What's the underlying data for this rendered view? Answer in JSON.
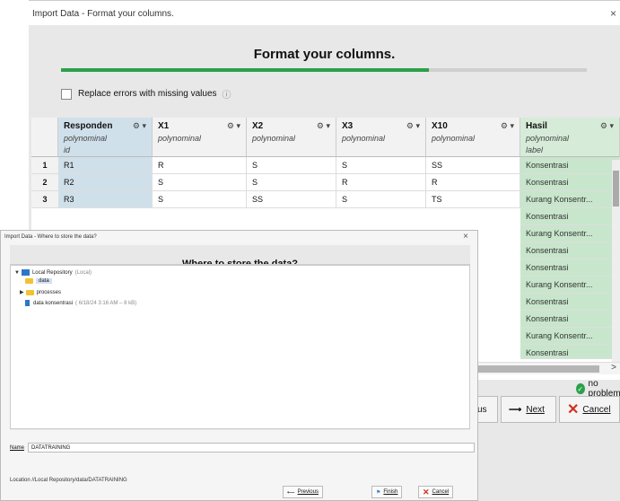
{
  "back": {
    "title": "Import Data - Format your columns.",
    "close": "×",
    "heading": "Format your columns.",
    "checkbox_label": "Replace errors with missing values",
    "columns": [
      {
        "name": "Responden",
        "type": "polynominal",
        "role": "id"
      },
      {
        "name": "X1",
        "type": "polynominal",
        "role": ""
      },
      {
        "name": "X2",
        "type": "polynominal",
        "role": ""
      },
      {
        "name": "X3",
        "type": "polynominal",
        "role": ""
      },
      {
        "name": "X10",
        "type": "polynominal",
        "role": ""
      },
      {
        "name": "Hasil",
        "type": "polynominal",
        "role": "label"
      }
    ],
    "rows": [
      {
        "num": "1",
        "cells": [
          "R1",
          "R",
          "S",
          "S",
          "SS"
        ]
      },
      {
        "num": "2",
        "cells": [
          "R2",
          "S",
          "S",
          "R",
          "R"
        ]
      },
      {
        "num": "3",
        "cells": [
          "R3",
          "S",
          "SS",
          "S",
          "TS"
        ]
      }
    ],
    "hasil": [
      "Konsentrasi",
      "Konsentrasi",
      "Kurang Konsentr...",
      "Konsentrasi",
      "Kurang Konsentr...",
      "Konsentrasi",
      "Konsentrasi",
      "Kurang Konsentr...",
      "Konsentrasi",
      "Konsentrasi",
      "Kurang Konsentr...",
      "Konsentrasi"
    ],
    "status": "no problems",
    "prev_partial": "us",
    "next": "Next",
    "cancel": "Cancel"
  },
  "front": {
    "title": "Import Data - Where to store the data?",
    "close": "×",
    "heading": "Where to store the data?",
    "root": "Local Repository",
    "root_note": "(Local)",
    "folder_data": "data",
    "folder_processes": "processes",
    "file_name": "data konsentrasi",
    "file_meta": "( 6/18/24 3:16 AM – 8 kB)",
    "name_label": "Name",
    "name_value": "DATATRAINING",
    "location": "Location //Local Repository/data/DATATRAINING",
    "previous": "Previous",
    "finish": "Finish",
    "cancel": "Cancel"
  }
}
